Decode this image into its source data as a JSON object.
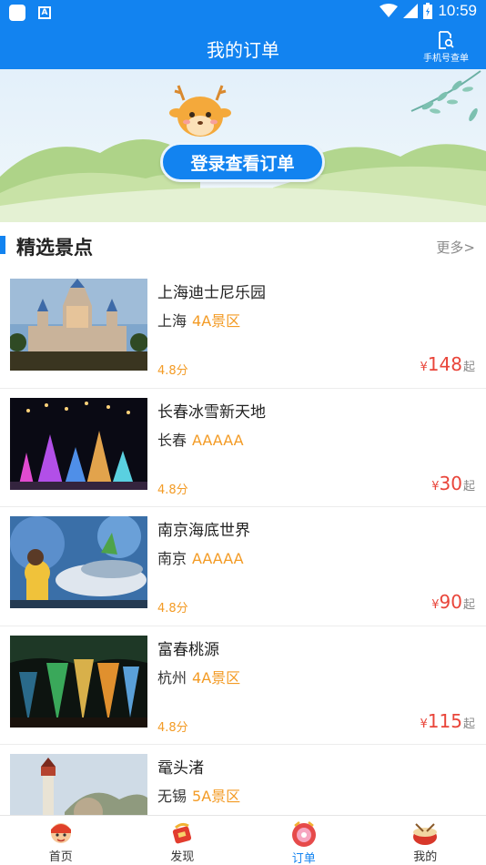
{
  "status_bar": {
    "time": "10:59"
  },
  "header": {
    "title": "我的订单",
    "phone_query_label": "手机号查单"
  },
  "banner": {
    "login_button": "登录查看订单"
  },
  "section": {
    "title": "精选景点",
    "more": "更多>"
  },
  "spots": [
    {
      "name": "上海迪士尼乐园",
      "city": "上海",
      "level": "4A景区",
      "score": "4.8分",
      "currency": "¥",
      "price": "148",
      "suffix": "起"
    },
    {
      "name": "长春冰雪新天地",
      "city": "长春",
      "level": "AAAAA",
      "score": "4.8分",
      "currency": "¥",
      "price": "30",
      "suffix": "起"
    },
    {
      "name": "南京海底世界",
      "city": "南京",
      "level": "AAAAA",
      "score": "4.8分",
      "currency": "¥",
      "price": "90",
      "suffix": "起"
    },
    {
      "name": "富春桃源",
      "city": "杭州",
      "level": "4A景区",
      "score": "4.8分",
      "currency": "¥",
      "price": "115",
      "suffix": "起"
    },
    {
      "name": "鼋头渚",
      "city": "无锡",
      "level": "5A景区",
      "score": "",
      "currency": "",
      "price": "",
      "suffix": ""
    }
  ],
  "bottom_nav": [
    {
      "label": "首页",
      "icon": "home-mascot-icon",
      "active": false
    },
    {
      "label": "发现",
      "icon": "discover-icon",
      "active": false
    },
    {
      "label": "订单",
      "icon": "order-icon",
      "active": true
    },
    {
      "label": "我的",
      "icon": "profile-icon",
      "active": false
    }
  ],
  "colors": {
    "primary": "#1283f0",
    "accent_orange": "#f39b25",
    "price_red": "#e9453a"
  }
}
